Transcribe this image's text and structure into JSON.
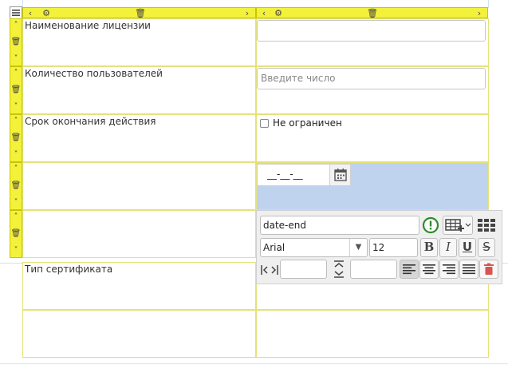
{
  "form": {
    "rows": [
      {
        "label": "Наименование лицензии",
        "value": "",
        "placeholder": ""
      },
      {
        "label": "Количество пользователей",
        "value": "",
        "placeholder": "Введите число"
      },
      {
        "label": "Срок окончания действия",
        "checkbox_label": "Не ограничен",
        "checked": false
      },
      {
        "label": "",
        "date_mask": "__-__-__"
      },
      {
        "label": ""
      },
      {
        "label": "Тип сертификата"
      },
      {
        "label": ""
      }
    ]
  },
  "panel": {
    "field_id": "date-end",
    "font_family": "Arial",
    "font_size": "12",
    "bold_label": "B",
    "italic_label": "I",
    "underline_label": "U",
    "strike_label": "S"
  },
  "colors": {
    "control_bar": "#f3f13a",
    "selected_cell": "#bfd3ee",
    "warning_icon": "#2e8b2e",
    "delete_icon": "#d9534f"
  }
}
